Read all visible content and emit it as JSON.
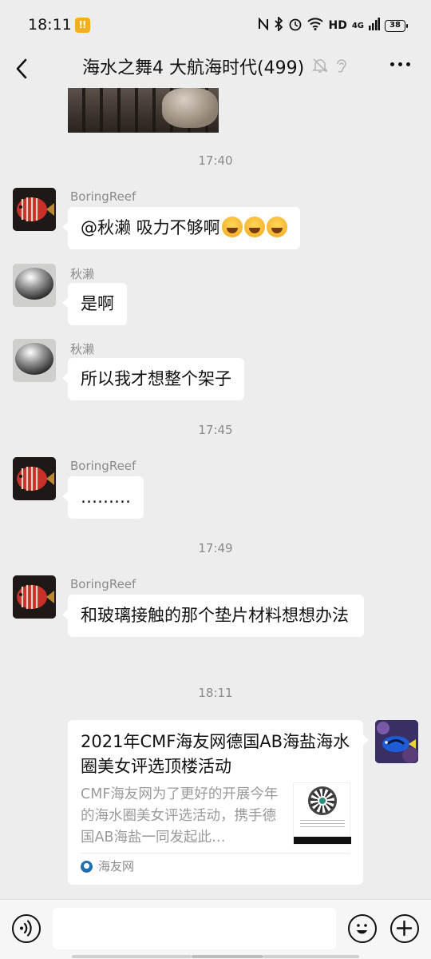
{
  "status_bar": {
    "time": "18:11",
    "app_badge": "ǃǃ",
    "network": "HD",
    "cellular": "4G",
    "battery": "38"
  },
  "header": {
    "title": "海水之舞4 大航海时代(499)"
  },
  "messages": [
    {
      "type": "timestamp",
      "text": "17:40"
    },
    {
      "type": "text",
      "sender": "BoringReef",
      "text": "@秋濑  吸力不够啊",
      "emoji_count": 3,
      "emoji": "joy-icon"
    },
    {
      "type": "text",
      "sender": "秋濑",
      "text": "是啊"
    },
    {
      "type": "text",
      "sender": "秋濑",
      "text": "所以我才想整个架子"
    },
    {
      "type": "timestamp",
      "text": "17:45"
    },
    {
      "type": "text",
      "sender": "BoringReef",
      "text": "………"
    },
    {
      "type": "timestamp",
      "text": "17:49"
    },
    {
      "type": "text",
      "sender": "BoringReef",
      "text": "和玻璃接触的那个垫片材料想想办法"
    },
    {
      "type": "timestamp",
      "text": "18:11"
    },
    {
      "type": "link_card",
      "title": "2021年CMF海友网德国AB海盐海水圈美女评选顶楼活动",
      "description": "CMF海友网为了更好的开展今年的海水圈美女评选活动，携手德国AB海盐一同发起此…",
      "source": "海友网"
    }
  ],
  "input": {
    "placeholder": ""
  },
  "colors": {
    "background": "#ededed",
    "bubble": "#ffffff",
    "timestamp_text": "#8a8a8a"
  }
}
